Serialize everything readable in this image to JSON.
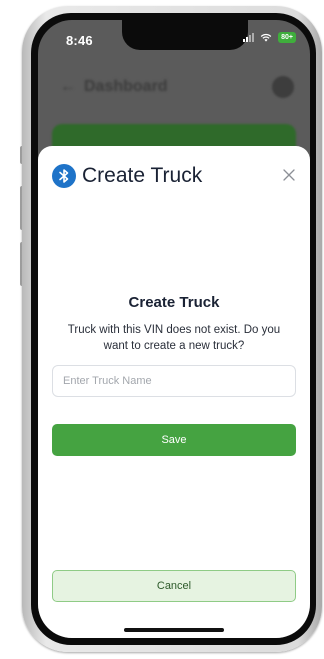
{
  "status_bar": {
    "time": "8:46",
    "battery": "80+",
    "signal_icon": "cellular-signal-icon",
    "wifi_icon": "wifi-icon"
  },
  "background": {
    "header_title": "Dashboard"
  },
  "modal": {
    "title": "Create Truck",
    "title_icon": "bluetooth-icon",
    "close_icon": "close-icon",
    "heading": "Create Truck",
    "message": "Truck with this VIN does not exist. Do you want to create a new truck?",
    "input": {
      "placeholder": "Enter Truck Name",
      "value": ""
    },
    "save_label": "Save",
    "cancel_label": "Cancel"
  },
  "colors": {
    "primary_green": "#45a341",
    "bluetooth_blue": "#1e73c8",
    "cancel_bg": "#e6f3e1",
    "cancel_border": "#8fcb86"
  }
}
